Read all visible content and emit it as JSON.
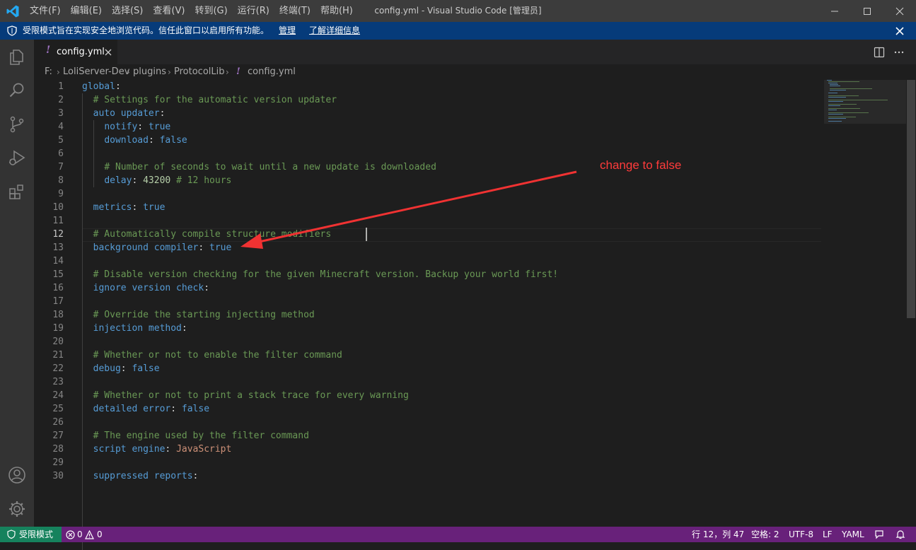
{
  "window": {
    "title": "config.yml - Visual Studio Code [管理员]",
    "menu": [
      "文件(F)",
      "编辑(E)",
      "选择(S)",
      "查看(V)",
      "转到(G)",
      "运行(R)",
      "终端(T)",
      "帮助(H)"
    ]
  },
  "banner": {
    "text": "受限模式旨在实现安全地浏览代码。信任此窗口以启用所有功能。",
    "manage_link": "管理",
    "learn_more_link": "了解详细信息"
  },
  "tab": {
    "label": "config.yml",
    "icon": "!"
  },
  "breadcrumb": [
    "F:",
    "LoliServer-Dev",
    "plugins",
    "ProtocolLib",
    "config.yml"
  ],
  "editor": {
    "cursor_line": 12,
    "lines": [
      "global:",
      "  # Settings for the automatic version updater",
      "  auto updater:",
      "    notify: true",
      "    download: false",
      "",
      "    # Number of seconds to wait until a new update is downloaded",
      "    delay: 43200 # 12 hours",
      "",
      "  metrics: true",
      "",
      "  # Automatically compile structure modifiers",
      "  background compiler: true",
      "",
      "  # Disable version checking for the given Minecraft version. Backup your world first!",
      "  ignore version check:",
      "",
      "  # Override the starting injecting method",
      "  injection method:",
      "",
      "  # Whether or not to enable the filter command",
      "  debug: false",
      "",
      "  # Whether or not to print a stack trace for every warning",
      "  detailed error: false",
      "",
      "  # The engine used by the filter command",
      "  script engine: JavaScript",
      "",
      "  suppressed reports:"
    ]
  },
  "annotation": {
    "text": "change to false",
    "color": "#ff3b3b"
  },
  "statusbar": {
    "mode": "受限模式",
    "errors": "0",
    "warnings": "0",
    "position": "行 12，列 47",
    "spaces": "空格: 2",
    "encoding": "UTF-8",
    "eol": "LF",
    "language": "YAML"
  },
  "colors": {
    "titlebar": "#3c3c3c",
    "banner": "#063b7a",
    "statusbar": "#68217a",
    "statusbar_left": "#16825d",
    "key": "#569cd6",
    "comment": "#6a9955",
    "number": "#b5cea8",
    "string": "#ce9178"
  },
  "icons": [
    "vscode-logo",
    "minimize-icon",
    "maximize-icon",
    "close-icon",
    "shield-icon",
    "explorer-icon",
    "search-icon",
    "source-control-icon",
    "run-debug-icon",
    "extensions-icon",
    "account-icon",
    "manage-gear-icon",
    "split-editor-icon",
    "more-actions-icon",
    "error-icon",
    "warning-icon",
    "feedback-icon",
    "bell-icon"
  ]
}
